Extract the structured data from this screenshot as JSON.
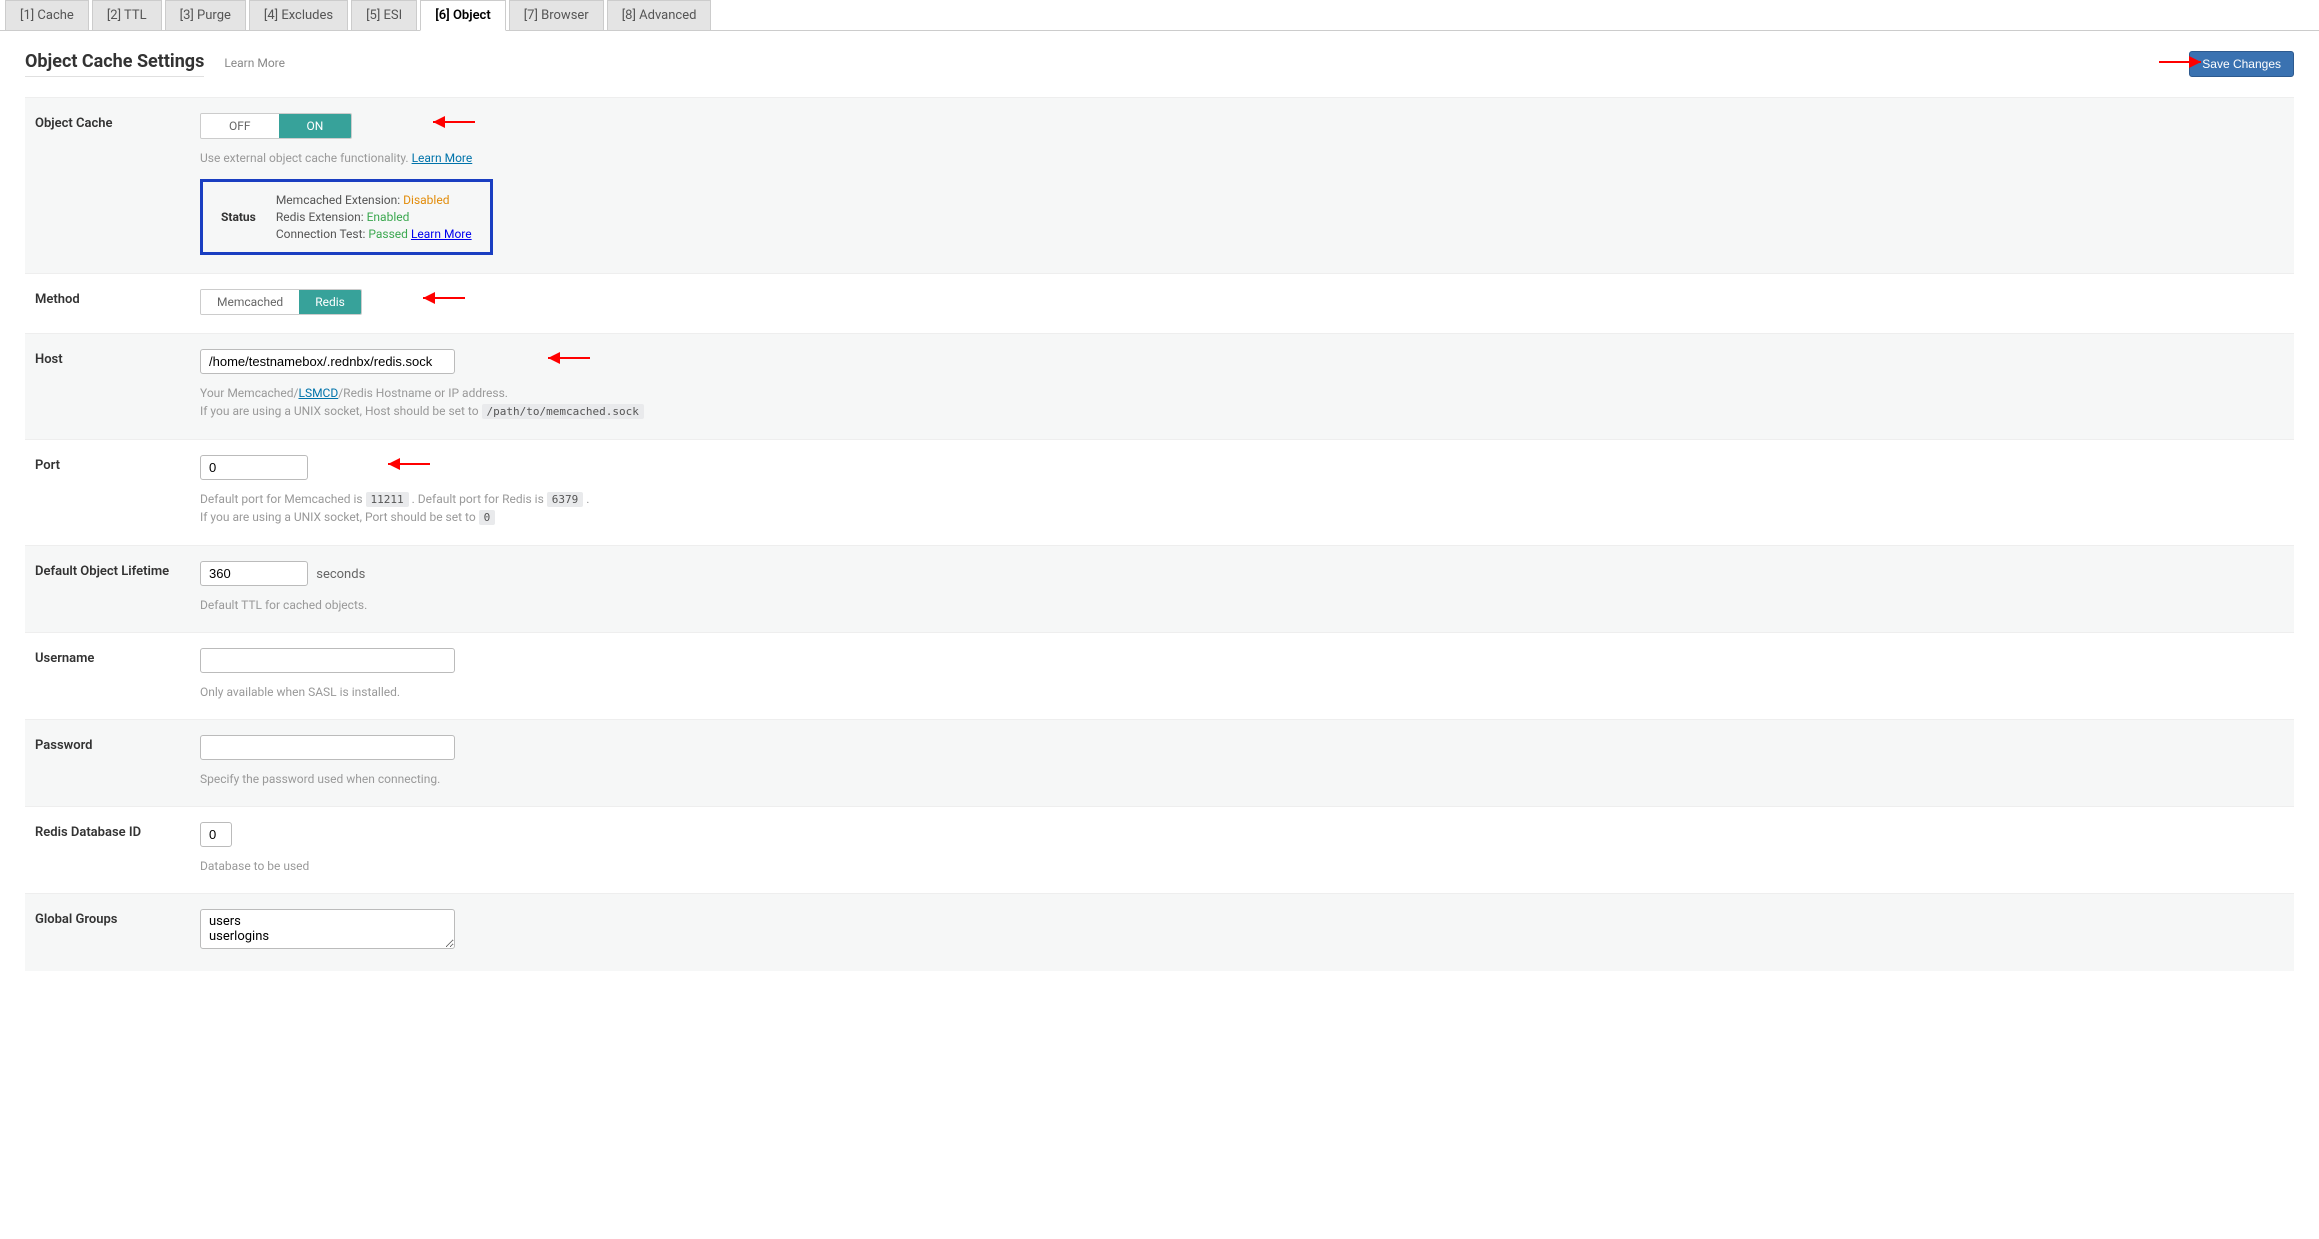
{
  "tabs": [
    {
      "label": "[1] Cache"
    },
    {
      "label": "[2] TTL"
    },
    {
      "label": "[3] Purge"
    },
    {
      "label": "[4] Excludes"
    },
    {
      "label": "[5] ESI"
    },
    {
      "label": "[6] Object"
    },
    {
      "label": "[7] Browser"
    },
    {
      "label": "[8] Advanced"
    }
  ],
  "page": {
    "title": "Object Cache Settings",
    "learn_more": "Learn More",
    "save_btn": "Save Changes"
  },
  "object_cache": {
    "label": "Object Cache",
    "off": "OFF",
    "on": "ON",
    "desc_prefix": "Use external object cache functionality. ",
    "desc_link": "Learn More"
  },
  "status": {
    "label": "Status",
    "memcached_ext": "Memcached Extension: ",
    "memcached_ext_val": "Disabled",
    "redis_ext": "Redis Extension: ",
    "redis_ext_val": "Enabled",
    "conn_test": "Connection Test: ",
    "conn_test_val": "Passed",
    "conn_test_link": "Learn More"
  },
  "method": {
    "label": "Method",
    "memcached": "Memcached",
    "redis": "Redis"
  },
  "host": {
    "label": "Host",
    "value": "/home/testnamebox/.rednbx/redis.sock",
    "desc1_a": "Your Memcached/",
    "desc1_link": "LSMCD",
    "desc1_b": "/Redis Hostname or IP address.",
    "desc2": "If you are using a UNIX socket, Host should be set to ",
    "desc2_code": "/path/to/memcached.sock"
  },
  "port": {
    "label": "Port",
    "value": "0",
    "desc1_a": "Default port for Memcached is ",
    "desc1_code_a": "11211",
    "desc1_b": " . Default port for Redis is ",
    "desc1_code_b": "6379",
    "desc1_c": " .",
    "desc2": "If you are using a UNIX socket, Port should be set to ",
    "desc2_code": "0"
  },
  "lifetime": {
    "label": "Default Object Lifetime",
    "value": "360",
    "unit": "seconds",
    "desc": "Default TTL for cached objects."
  },
  "username": {
    "label": "Username",
    "value": "",
    "desc": "Only available when SASL is installed."
  },
  "password": {
    "label": "Password",
    "value": "",
    "desc": "Specify the password used when connecting."
  },
  "redis_db": {
    "label": "Redis Database ID",
    "value": "0",
    "desc": "Database to be used"
  },
  "global_groups": {
    "label": "Global Groups",
    "value": "users\nuserlogins"
  }
}
